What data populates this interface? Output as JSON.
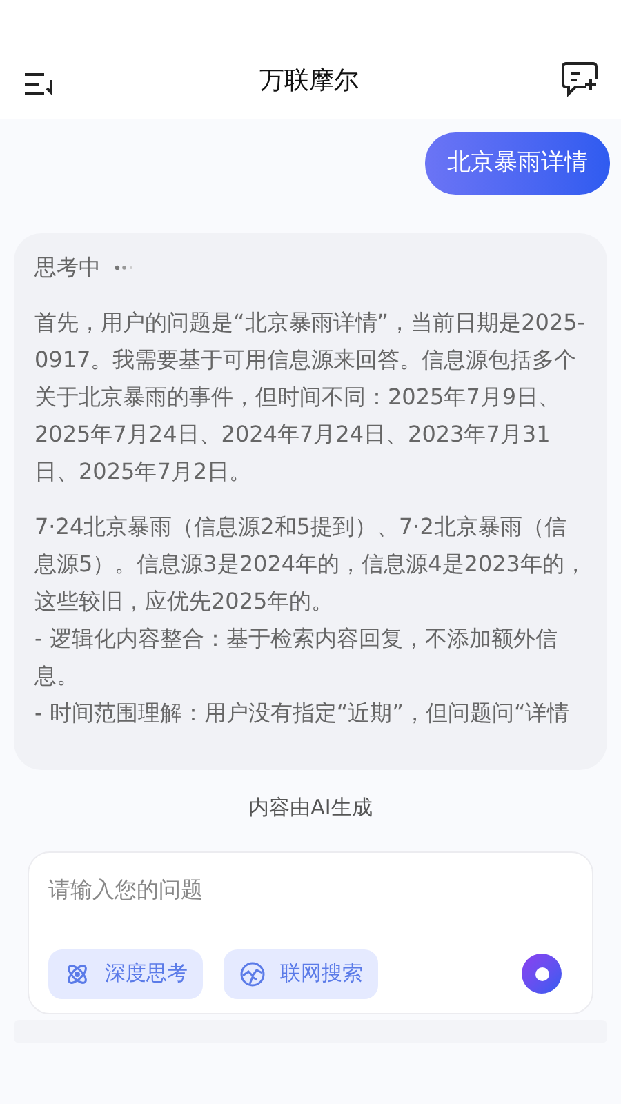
{
  "header": {
    "title": "万联摩尔"
  },
  "user_message": "北京暴雨详情",
  "thinking": {
    "status": "思考中",
    "sections": [
      {
        "lines": [
          "首先，用户的问题是“北京暴雨详情”，当前日期是2025-0917。我需要基于可用信息源来回答。信息源包括多个关于北京暴雨的事件，但时间不同：2025年7月9日、2025年7月24日、2024年7月24日、2023年7月31日、2025年7月2日。"
        ]
      },
      {
        "lines": [
          "7·24北京暴雨（信息源2和5提到）、7·2北京暴雨（信息源5）。信息源3是2024年的，信息源4是2023年的，这些较旧，应优先2025年的。",
          "- 逻辑化内容整合：基于检索内容回复，不添加额外信息。",
          "- 时间范围理解：用户没有指定“近期”，但问题问“详情"
        ]
      }
    ]
  },
  "disclaimer": "内容由AI生成",
  "input": {
    "placeholder": "请输入您的问题"
  },
  "chips": [
    {
      "kind": "deep",
      "label": "深度思考"
    },
    {
      "kind": "web",
      "label": "联网搜索"
    }
  ]
}
